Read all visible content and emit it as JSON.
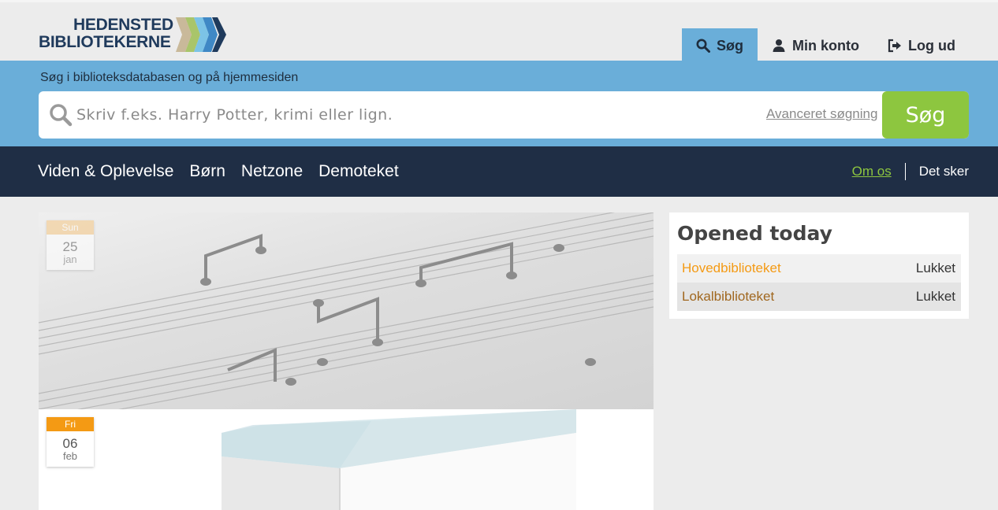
{
  "logo": {
    "line1": "HEDENSTED",
    "line2": "BIBLIOTEKERNE"
  },
  "topnav": [
    {
      "label": "Søg",
      "icon": "search-icon"
    },
    {
      "label": "Min konto",
      "icon": "user-icon"
    },
    {
      "label": "Log ud",
      "icon": "logout-icon"
    }
  ],
  "search": {
    "title": "Søg i biblioteksdatabasen og på hjemmesiden",
    "placeholder": "Skriv f.eks. Harry Potter, krimi eller lign.",
    "advanced_label": "Avanceret søgning",
    "button_label": "Søg"
  },
  "mainnav": {
    "items": [
      "Viden & Oplevelse",
      "Børn",
      "Netzone",
      "Demoteket"
    ],
    "right": [
      "Om os",
      "Det sker"
    ]
  },
  "events": [
    {
      "day": "Sun",
      "date": "25",
      "month": "jan"
    },
    {
      "day": "Fri",
      "date": "06",
      "month": "feb"
    }
  ],
  "hours": {
    "title": "Opened today",
    "rows": [
      {
        "name": "Hovedbiblioteket",
        "status": "Lukket"
      },
      {
        "name": "Lokalbiblioteket",
        "status": "Lukket"
      }
    ]
  },
  "colors": {
    "brand_blue": "#6aaed9",
    "nav_dark": "#1f2e45",
    "accent_green": "#8dc63f",
    "accent_orange": "#f49a14"
  }
}
